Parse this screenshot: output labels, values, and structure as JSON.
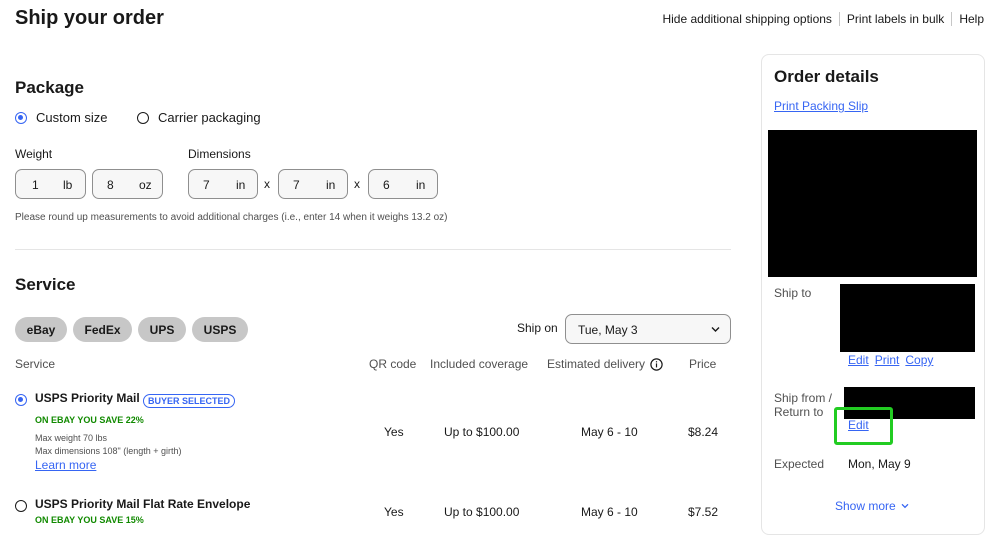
{
  "header": {
    "title": "Ship your order",
    "links": [
      "Hide additional shipping options",
      "Print labels in bulk",
      "Help"
    ]
  },
  "package": {
    "title": "Package",
    "options": [
      {
        "label": "Custom size",
        "selected": true
      },
      {
        "label": "Carrier packaging",
        "selected": false
      }
    ],
    "weight_label": "Weight",
    "weight_lb": "1",
    "weight_lb_unit": "lb",
    "weight_oz": "8",
    "weight_oz_unit": "oz",
    "dimensions_label": "Dimensions",
    "dims": [
      "7",
      "7",
      "6"
    ],
    "dim_unit": "in",
    "times": "x",
    "note": "Please round up measurements to avoid additional charges (i.e., enter 14 when it weighs 13.2 oz)"
  },
  "service": {
    "title": "Service",
    "carriers": [
      "eBay",
      "FedEx",
      "UPS",
      "USPS"
    ],
    "ship_on_label": "Ship on",
    "ship_on_value": "Tue, May 3",
    "columns": {
      "service": "Service",
      "qr": "QR code",
      "coverage": "Included coverage",
      "delivery": "Estimated delivery",
      "price": "Price"
    },
    "rows": [
      {
        "name": "USPS Priority Mail",
        "badge": "BUYER SELECTED",
        "save": "ON EBAY YOU SAVE 22%",
        "detail1": "Max weight 70 lbs",
        "detail2": "Max dimensions 108\" (length + girth)",
        "learn_more": "Learn more",
        "qr": "Yes",
        "coverage": "Up to $100.00",
        "delivery": "May 6 - 10",
        "price": "$8.24",
        "selected": true
      },
      {
        "name": "USPS Priority Mail Flat Rate Envelope",
        "save": "ON EBAY YOU SAVE 15%",
        "qr": "Yes",
        "coverage": "Up to $100.00",
        "delivery": "May 6 - 10",
        "price": "$7.52",
        "selected": false
      }
    ]
  },
  "order": {
    "title": "Order details",
    "packing_slip": "Print Packing Slip",
    "ship_to_label": "Ship to",
    "ship_to_links": [
      "Edit",
      "Print",
      "Copy"
    ],
    "ship_from_label_1": "Ship from /",
    "ship_from_label_2": "Return to",
    "ship_from_edit": "Edit",
    "expected_label": "Expected",
    "expected_value": "Mon, May 9",
    "show_more": "Show more"
  },
  "colors": {
    "accent": "#3665f3",
    "save_green": "#118a00",
    "highlight": "#22cc22"
  }
}
